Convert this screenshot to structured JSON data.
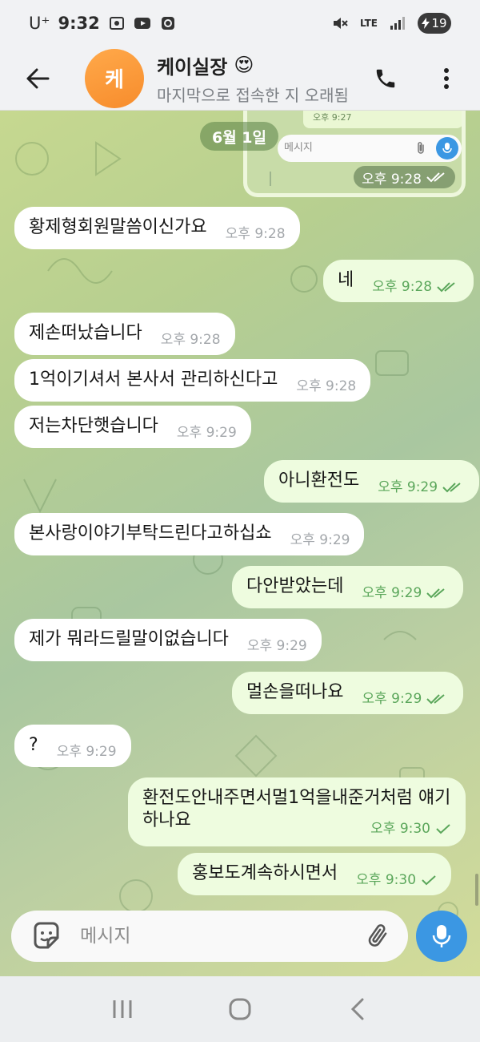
{
  "status_bar": {
    "carrier": "U⁺",
    "time": "9:32",
    "network": "LTE",
    "battery": "19"
  },
  "header": {
    "avatar_text": "케",
    "title": "케이실장",
    "title_emoji": "😍",
    "subtitle": "마지막으로 접속한 지 오래됨"
  },
  "chat": {
    "date_label": "6월 1일",
    "image_message": {
      "inner_time": "오후 9:27",
      "inner_placeholder": "메시지",
      "time": "오후 9:28"
    },
    "messages": [
      {
        "dir": "in",
        "text": "황제형회원말씀이신가요",
        "time": "오후 9:28"
      },
      {
        "dir": "out",
        "text": "네",
        "time": "오후 9:28",
        "status": "read"
      },
      {
        "dir": "in",
        "text": "제손떠났습니다",
        "time": "오후 9:28"
      },
      {
        "dir": "in",
        "text": "1억이기셔서 본사서 관리하신다고",
        "time": "오후 9:28"
      },
      {
        "dir": "in",
        "text": "저는차단햇습니다",
        "time": "오후 9:29"
      },
      {
        "dir": "out",
        "text": "아니환전도",
        "time": "오후 9:29",
        "status": "read"
      },
      {
        "dir": "in",
        "text": "본사랑이야기부탁드린다고하십쇼",
        "time": "오후 9:29"
      },
      {
        "dir": "out",
        "text": "다안받았는데",
        "time": "오후 9:29",
        "status": "read"
      },
      {
        "dir": "in",
        "text": "제가 뭐라드릴말이없습니다",
        "time": "오후 9:29"
      },
      {
        "dir": "out",
        "text": "멀손을떠나요",
        "time": "오후 9:29",
        "status": "read"
      },
      {
        "dir": "in",
        "text": "?",
        "time": "오후 9:29"
      },
      {
        "dir": "out",
        "text": "환전도안내주면서멀1억을내준거처럼 얘기하나요",
        "time": "오후 9:30",
        "status": "sent"
      },
      {
        "dir": "out",
        "text": "홍보도계속하시면서",
        "time": "오후 9:30",
        "status": "sent"
      }
    ]
  },
  "input": {
    "placeholder": "메시지"
  },
  "colors": {
    "accent": "#3b97e3",
    "avatar": "#f79a36",
    "outgoing_bubble": "#eefcdf",
    "incoming_bubble": "#ffffff",
    "check_color": "#5aa65a"
  }
}
